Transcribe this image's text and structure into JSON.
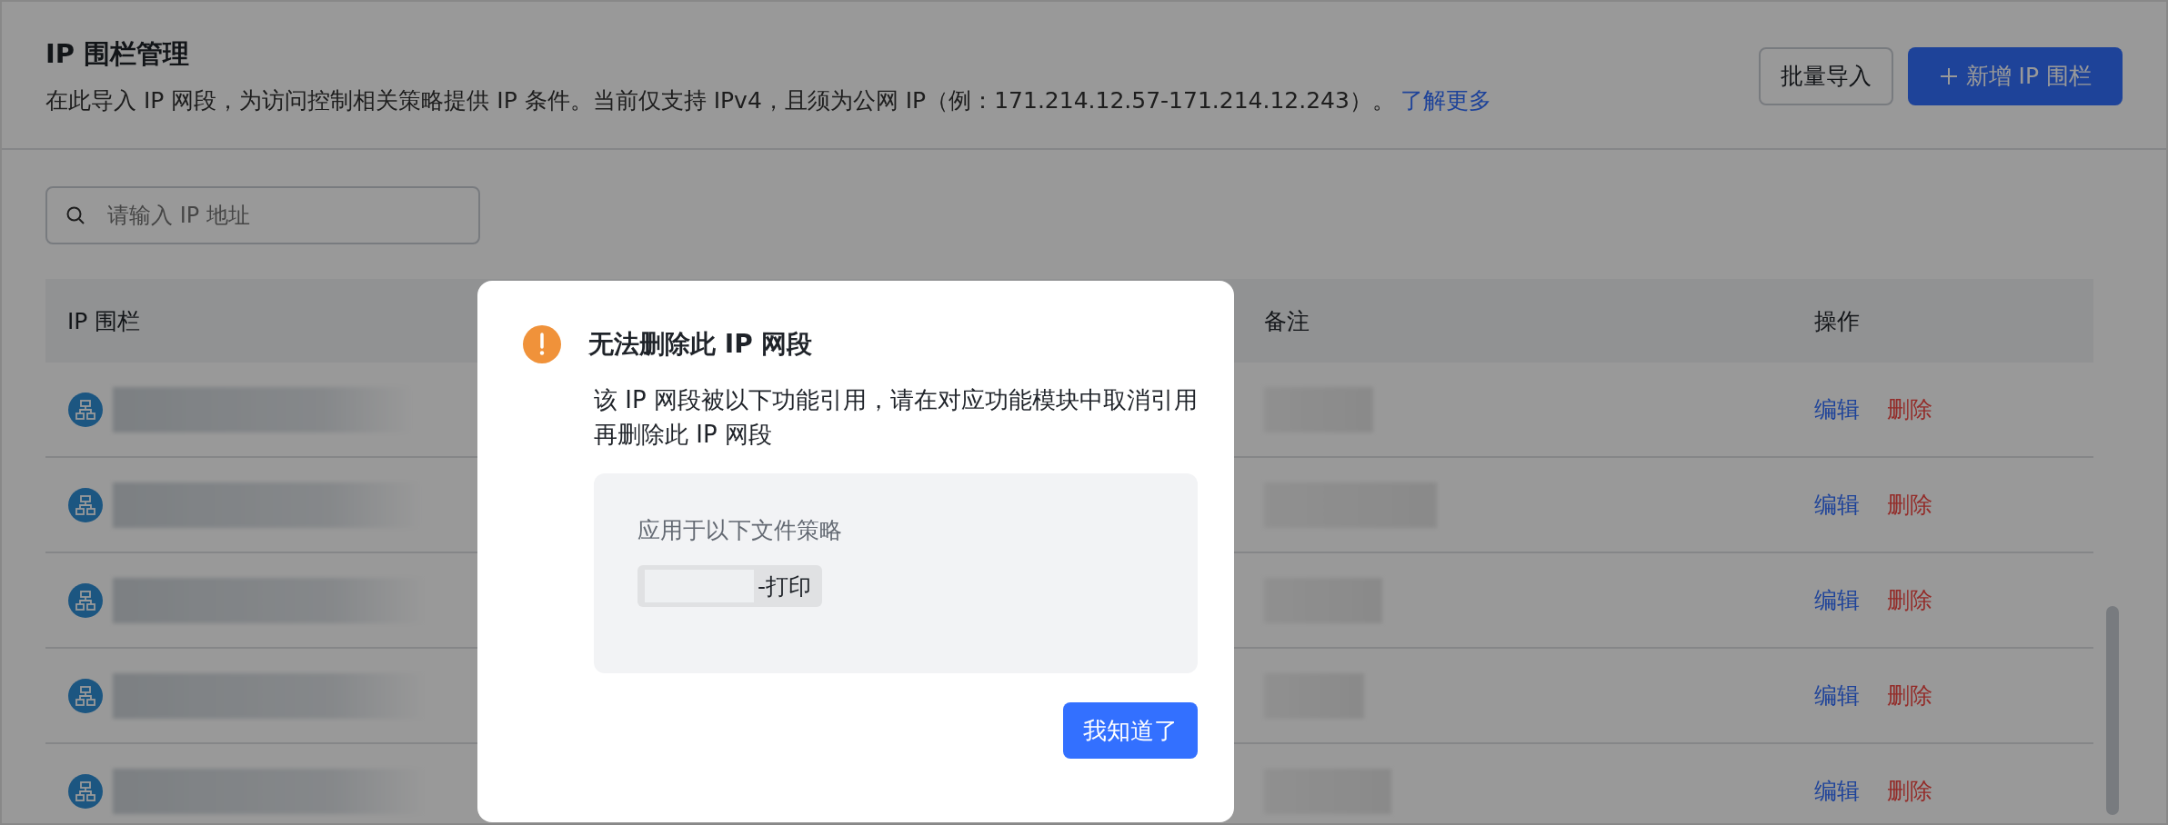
{
  "header": {
    "title": "IP 围栏管理",
    "description": "在此导入 IP 网段，为访问控制相关策略提供 IP 条件。当前仅支持 IPv4，且须为公网 IP（例：171.214.12.57-171.214.12.243）。",
    "learn_more": "了解更多"
  },
  "actions": [
    {
      "label": "批量导入",
      "kind": "default"
    },
    {
      "label": "新增 IP 围栏",
      "kind": "primary"
    }
  ],
  "search": {
    "placeholder": "请输入 IP 地址"
  },
  "table": {
    "columns": [
      "IP 围栏",
      "备注",
      "操作"
    ],
    "rows": [
      {
        "edit": "编辑",
        "delete": "删除"
      },
      {
        "edit": "编辑",
        "delete": "删除"
      },
      {
        "edit": "编辑",
        "delete": "删除"
      },
      {
        "edit": "编辑",
        "delete": "删除"
      },
      {
        "edit": "编辑",
        "delete": "删除"
      }
    ]
  },
  "dialog": {
    "title": "无法删除此 IP 网段",
    "message": "该 IP 网段被以下功能引用，请在对应功能模块中取消引用再删除此 IP 网段",
    "box_title": "应用于以下文件策略",
    "policies": [
      "-打印"
    ],
    "ok": "我知道了"
  }
}
